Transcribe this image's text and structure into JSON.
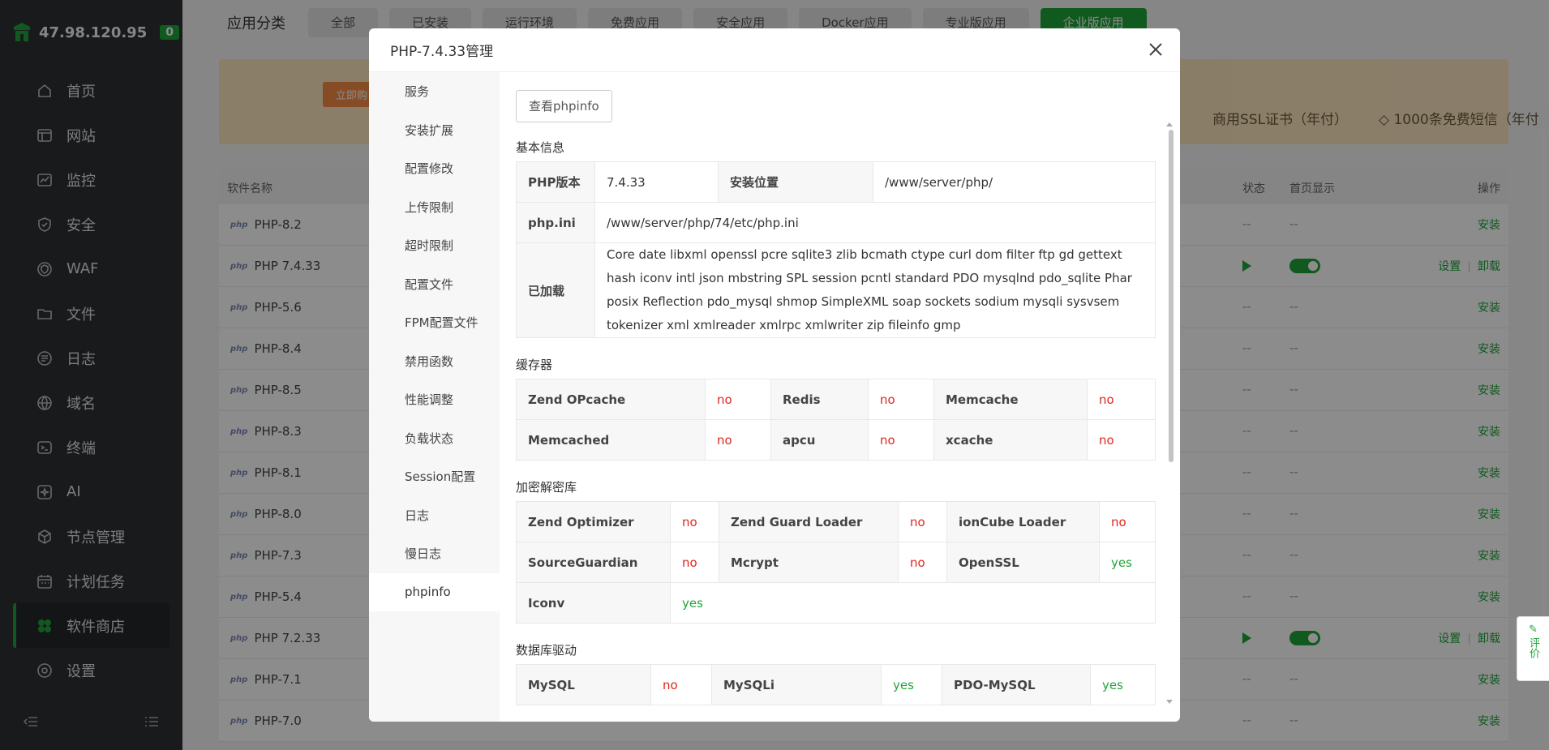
{
  "sidebar": {
    "ip": "47.98.120.95",
    "badge": "0",
    "items": [
      {
        "label": "首页",
        "icon": "home-icon"
      },
      {
        "label": "网站",
        "icon": "website-icon"
      },
      {
        "label": "监控",
        "icon": "monitor-icon"
      },
      {
        "label": "安全",
        "icon": "shield-icon"
      },
      {
        "label": "WAF",
        "icon": "waf-icon"
      },
      {
        "label": "文件",
        "icon": "folder-icon"
      },
      {
        "label": "日志",
        "icon": "log-icon"
      },
      {
        "label": "域名",
        "icon": "globe-icon"
      },
      {
        "label": "终端",
        "icon": "terminal-icon"
      },
      {
        "label": "AI",
        "icon": "ai-icon"
      },
      {
        "label": "节点管理",
        "icon": "cube-icon"
      },
      {
        "label": "计划任务",
        "icon": "calendar-icon"
      },
      {
        "label": "软件商店",
        "icon": "store-icon"
      },
      {
        "label": "设置",
        "icon": "settings-icon"
      }
    ],
    "active_index": 12
  },
  "main": {
    "category_label": "应用分类",
    "categories": [
      "全部",
      "已安装",
      "运行环境",
      "免费应用",
      "安全应用",
      "Docker应用",
      "专业版应用",
      "企业版应用"
    ],
    "active_category": 7,
    "banner": {
      "tag": "立即购",
      "ssl": "商用SSL证书（年付）",
      "sms": "1000条免费短信（年付"
    },
    "table_headers": {
      "name": "软件名称",
      "status": "状态",
      "home": "首页显示",
      "ops": "操作"
    },
    "rows": [
      {
        "name": "PHP-8.2",
        "status": "--",
        "home": "--",
        "op": "安装"
      },
      {
        "name": "PHP 7.4.33",
        "installed": true,
        "set": "设置",
        "op": "卸载"
      },
      {
        "name": "PHP-5.6",
        "status": "--",
        "home": "--",
        "op": "安装"
      },
      {
        "name": "PHP-8.4",
        "status": "--",
        "home": "--",
        "op": "安装"
      },
      {
        "name": "PHP-8.5",
        "status": "--",
        "home": "--",
        "op": "安装"
      },
      {
        "name": "PHP-8.3",
        "status": "--",
        "home": "--",
        "op": "安装"
      },
      {
        "name": "PHP-8.1",
        "status": "--",
        "home": "--",
        "op": "安装"
      },
      {
        "name": "PHP-8.0",
        "status": "--",
        "home": "--",
        "op": "安装"
      },
      {
        "name": "PHP-7.3",
        "status": "--",
        "home": "--",
        "op": "安装"
      },
      {
        "name": "PHP-5.4",
        "status": "--",
        "home": "--",
        "op": "安装"
      },
      {
        "name": "PHP 7.2.33",
        "installed": true,
        "set": "设置",
        "op": "卸载"
      },
      {
        "name": "PHP-7.1",
        "status": "--",
        "home": "--",
        "op": "安装"
      },
      {
        "name": "PHP-7.0",
        "status": "--",
        "home": "--",
        "op": "安装"
      }
    ],
    "php_mark": "php",
    "feedback": "评价"
  },
  "modal": {
    "title": "PHP-7.4.33管理",
    "nav": [
      "服务",
      "安装扩展",
      "配置修改",
      "上传限制",
      "超时限制",
      "配置文件",
      "FPM配置文件",
      "禁用函数",
      "性能调整",
      "负载状态",
      "Session配置",
      "日志",
      "慢日志",
      "phpinfo"
    ],
    "active_nav": 13,
    "phpinfo_button": "查看phpinfo",
    "basic": {
      "title": "基本信息",
      "php_version_label": "PHP版本",
      "php_version": "7.4.33",
      "install_path_label": "安装位置",
      "install_path": "/www/server/php/",
      "ini_label": "php.ini",
      "ini_path": "/www/server/php/74/etc/php.ini",
      "loaded_label": "已加载",
      "loaded": "Core date libxml openssl pcre sqlite3 zlib bcmath ctype curl dom filter ftp gd gettext hash iconv intl json mbstring SPL session pcntl standard PDO mysqlnd pdo_sqlite Phar posix Reflection pdo_mysql shmop SimpleXML soap sockets sodium mysqli sysvsem tokenizer xml xmlreader xmlrpc xmlwriter zip fileinfo gmp"
    },
    "cache": {
      "title": "缓存器",
      "rows": [
        [
          {
            "k": "Zend OPcache",
            "v": "no"
          },
          {
            "k": "Redis",
            "v": "no"
          },
          {
            "k": "Memcache",
            "v": "no"
          }
        ],
        [
          {
            "k": "Memcached",
            "v": "no"
          },
          {
            "k": "apcu",
            "v": "no"
          },
          {
            "k": "xcache",
            "v": "no"
          }
        ]
      ]
    },
    "crypto": {
      "title": "加密解密库",
      "rows": [
        [
          {
            "k": "Zend Optimizer",
            "v": "no"
          },
          {
            "k": "Zend Guard Loader",
            "v": "no"
          },
          {
            "k": "ionCube Loader",
            "v": "no"
          }
        ],
        [
          {
            "k": "SourceGuardian",
            "v": "no"
          },
          {
            "k": "Mcrypt",
            "v": "no"
          },
          {
            "k": "OpenSSL",
            "v": "yes"
          }
        ],
        [
          {
            "k": "Iconv",
            "v": "yes"
          }
        ]
      ]
    },
    "db": {
      "title": "数据库驱动",
      "rows": [
        [
          {
            "k": "MySQL",
            "v": "no"
          },
          {
            "k": "MySQLi",
            "v": "yes"
          },
          {
            "k": "PDO-MySQL",
            "v": "yes"
          }
        ]
      ]
    }
  }
}
